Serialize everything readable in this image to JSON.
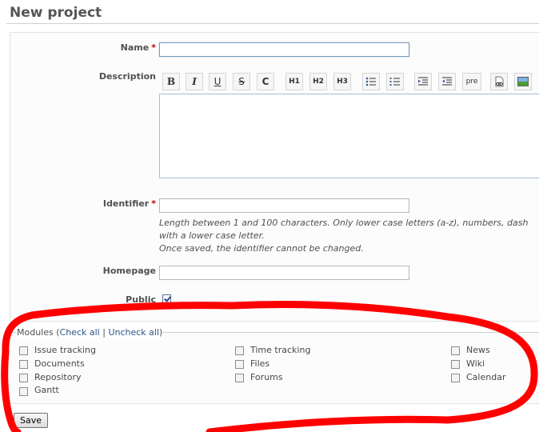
{
  "page": {
    "title": "New project"
  },
  "form": {
    "name_label": "Name",
    "description_label": "Description",
    "identifier_label": "Identifier",
    "homepage_label": "Homepage",
    "public_label": "Public",
    "required_mark": "*",
    "name_value": "",
    "identifier_value": "",
    "homepage_value": "",
    "public_checked": true,
    "identifier_hint_line1": "Length between 1 and 100 characters. Only lower case letters (a-z), numbers, dash",
    "identifier_hint_line2": "with a lower case letter.",
    "identifier_hint_line3": "Once saved, the identifier cannot be changed."
  },
  "toolbar": {
    "buttons": [
      {
        "name": "bold",
        "glyph": "B"
      },
      {
        "name": "italic",
        "glyph": "I"
      },
      {
        "name": "underline",
        "glyph": "U"
      },
      {
        "name": "strikethrough",
        "glyph": "S"
      },
      {
        "name": "code",
        "glyph": "C"
      },
      {
        "name": "heading-1",
        "glyph": "H1"
      },
      {
        "name": "heading-2",
        "glyph": "H2"
      },
      {
        "name": "heading-3",
        "glyph": "H3"
      },
      {
        "name": "unordered-list",
        "glyph": ""
      },
      {
        "name": "ordered-list",
        "glyph": ""
      },
      {
        "name": "quote",
        "glyph": ""
      },
      {
        "name": "unquote",
        "glyph": ""
      },
      {
        "name": "preformatted",
        "glyph": "pre"
      },
      {
        "name": "wiki-link",
        "glyph": ""
      },
      {
        "name": "image",
        "glyph": ""
      }
    ]
  },
  "modules": {
    "legend": "Modules",
    "check_all": "Check all",
    "uncheck_all": "Uncheck all",
    "separator": "|",
    "open_paren": "(",
    "close_paren": ")",
    "items": [
      {
        "label": "Issue tracking",
        "checked": false
      },
      {
        "label": "Time tracking",
        "checked": false
      },
      {
        "label": "News",
        "checked": false
      },
      {
        "label": "Documents",
        "checked": false
      },
      {
        "label": "Files",
        "checked": false
      },
      {
        "label": "Wiki",
        "checked": false
      },
      {
        "label": "Repository",
        "checked": false
      },
      {
        "label": "Forums",
        "checked": false
      },
      {
        "label": "Calendar",
        "checked": false
      },
      {
        "label": "Gantt",
        "checked": false
      }
    ]
  },
  "actions": {
    "save_label": "Save"
  },
  "colors": {
    "annotation": "#ff0000",
    "link": "#2a5685",
    "required": "#bb0000"
  }
}
